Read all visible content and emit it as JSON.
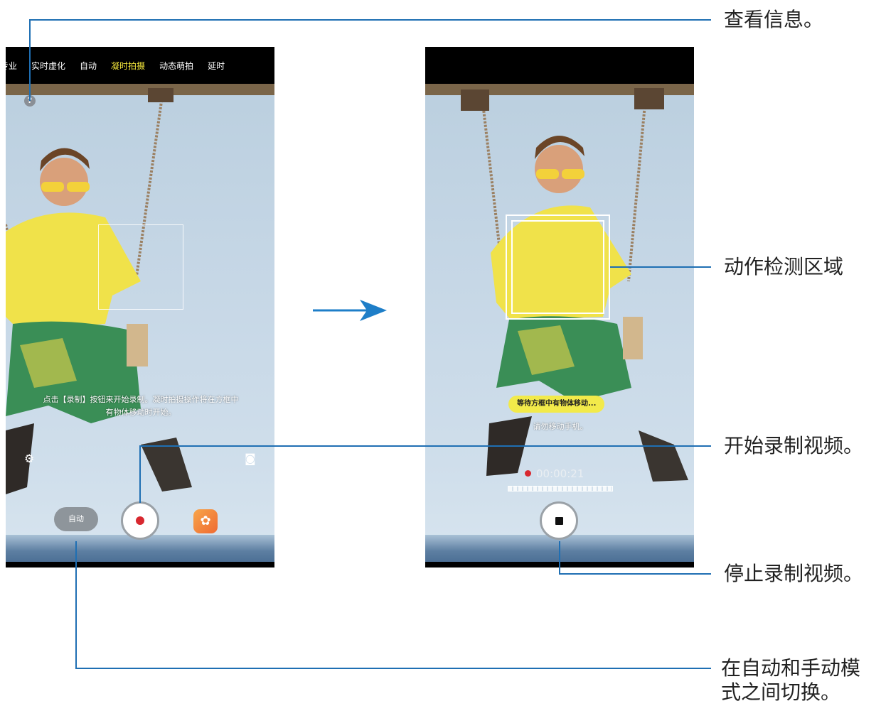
{
  "phone1": {
    "mode_tabs": [
      "专业",
      "实时虚化",
      "自动",
      "凝时拍摄",
      "动态萌拍",
      "延时"
    ],
    "active_tab": "凝时拍摄",
    "help_glyph": "?",
    "hint_text_line1": "点击【录制】按钮来开始录制。凝时拍摄操作将在方框中",
    "hint_text_line2": "有物体移动时开始。",
    "auto_button_label": "自动"
  },
  "phone2": {
    "wait_badge": "等待方框中有物体移动...",
    "hold_text": "请勿移动手机。",
    "timer": "00:00:21"
  },
  "callouts": {
    "view_info": "查看信息。",
    "motion_zone": "动作检测区域",
    "start_recording": "开始录制视频。",
    "stop_recording": "停止录制视频。",
    "switch_mode_line1": "在自动和手动模",
    "switch_mode_line2": "式之间切换。"
  },
  "colors": {
    "line": "#1f6fb3",
    "arrow": "#1e7ec8",
    "active_tab": "#f2e53b",
    "record_red": "#d8282f"
  },
  "icons": [
    "help-icon",
    "settings-icon",
    "switch-camera-icon",
    "record-icon",
    "stop-icon",
    "effects-icon",
    "arrow-right-icon"
  ]
}
